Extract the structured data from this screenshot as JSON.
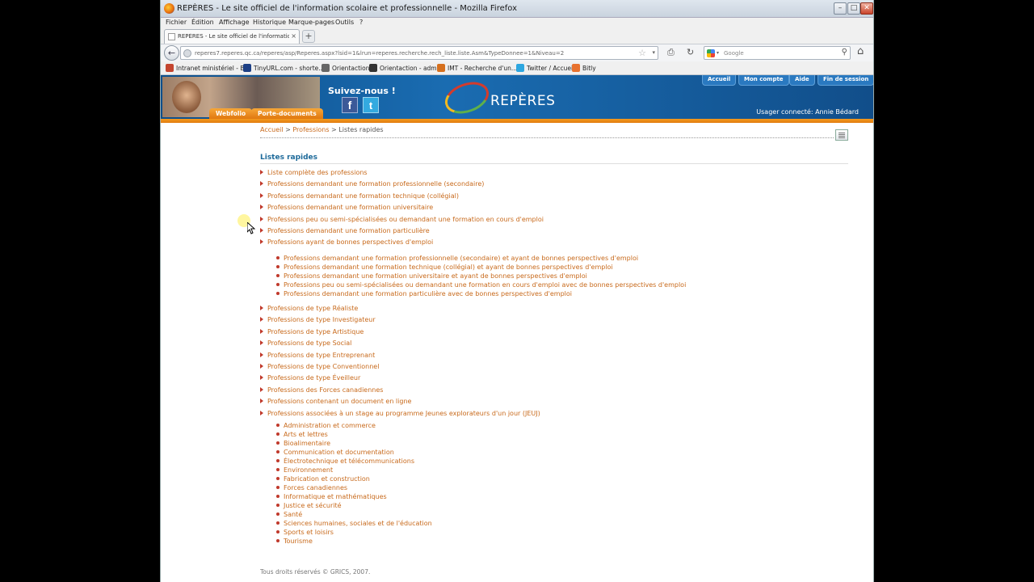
{
  "window": {
    "title": "REPÈRES - Le site officiel de l'information scolaire et professionnelle - Mozilla Firefox",
    "minimize": "–",
    "maximize": "□",
    "close": "✕"
  },
  "menu": [
    "Fichier",
    "Édition",
    "Affichage",
    "Historique",
    "Marque-pages",
    "Outils",
    "?"
  ],
  "tab": {
    "title": "REPÈRES - Le site officiel de l'information sco...",
    "close": "×",
    "new_tab": "+"
  },
  "nav": {
    "back": "←",
    "url": "reperes7.reperes.qc.ca/reperes/asp/Reperes.aspx?lsid=1&lrun=reperes.recherche.rech_liste.liste.Asm&TypeDonnee=1&Niveau=2",
    "star": "☆",
    "dropdown": "▾",
    "print": "⎙",
    "reload": "↻",
    "home": "⌂",
    "search_placeholder": "Google",
    "search_engine_arrow": "▾",
    "search_button": "⚲"
  },
  "bookmarks": [
    {
      "label": "Intranet ministériel - B...",
      "icon_color": "#c4452f"
    },
    {
      "label": "TinyURL.com - shorte...",
      "icon_color": "#1d3f85"
    },
    {
      "label": "Orientaction",
      "icon_color": "#666666"
    },
    {
      "label": "Orientaction - admin",
      "icon_color": "#333333"
    },
    {
      "label": "IMT - Recherche d'un...",
      "icon_color": "#d6701e"
    },
    {
      "label": "Twitter / Accueil",
      "icon_color": "#2ea7e0"
    },
    {
      "label": "Bitly",
      "icon_color": "#e8722f"
    }
  ],
  "banner": {
    "follow_label": "Suivez-nous !",
    "facebook_glyph": "f",
    "twitter_glyph": "t",
    "logo_text": "REPÈRES",
    "tabs": [
      "Webfolio",
      "Porte-documents"
    ],
    "top_links": [
      "Accueil",
      "Mon compte",
      "Aide",
      "Fin de session"
    ],
    "user": "Usager connecté: Annie Bédard"
  },
  "breadcrumb": {
    "home": "Accueil",
    "sep1": " > ",
    "professions": "Professions",
    "sep2": " > ",
    "current": "Listes rapides"
  },
  "heading": "Listes rapides",
  "list_group_1": [
    "Liste complète des professions",
    "Professions demandant une formation professionnelle (secondaire)",
    "Professions demandant une formation technique (collégial)",
    "Professions demandant une formation universitaire",
    "Professions peu ou semi-spécialisées ou demandant une formation en cours d'emploi",
    "Professions demandant une formation particulière",
    "Professions ayant de bonnes perspectives d'emploi"
  ],
  "sublist_1": [
    "Professions demandant une formation professionnelle (secondaire) et ayant de bonnes perspectives d'emploi",
    "Professions demandant une formation technique (collégial) et ayant de bonnes perspectives d'emploi",
    "Professions demandant une formation universitaire et ayant de bonnes perspectives d'emploi",
    "Professions peu ou semi-spécialisées ou demandant une formation en cours d'emploi avec de bonnes perspectives d'emploi",
    "Professions demandant une formation particulière avec de bonnes perspectives d'emploi"
  ],
  "list_group_2": [
    "Professions de type Réaliste",
    "Professions de type Investigateur",
    "Professions de type Artistique",
    "Professions de type Social",
    "Professions de type Entreprenant",
    "Professions de type Conventionnel",
    "Professions de type Éveilleur",
    "Professions des Forces canadiennes",
    "Professions contenant un document en ligne",
    "Professions associées à un stage au programme Jeunes explorateurs d'un jour (JEUJ)"
  ],
  "sublist_2": [
    "Administration et commerce",
    "Arts et lettres",
    "Bioalimentaire",
    "Communication et documentation",
    "Électrotechnique et télécommunications",
    "Environnement",
    "Fabrication et construction",
    "Forces canadiennes",
    "Informatique et mathématiques",
    "Justice et sécurité",
    "Santé",
    "Sciences humaines, sociales et de l'éducation",
    "Sports et loisirs",
    "Tourisme"
  ],
  "footer": "Tous droits réservés © GRICS, 2007."
}
